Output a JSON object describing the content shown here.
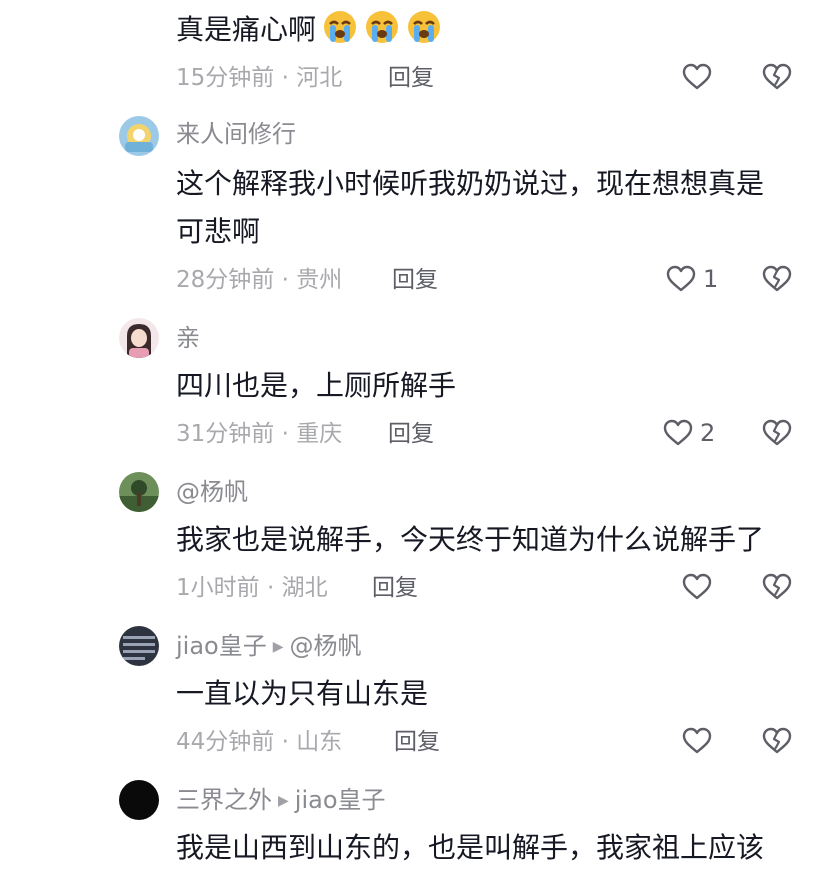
{
  "comments": [
    {
      "content": "真是痛心啊",
      "emoji_count": 3,
      "time": "15分钟前",
      "location": "河北",
      "reply_label": "回复",
      "likes": ""
    },
    {
      "username": "来人间修行",
      "content_line1": "这个解释我小时候听我奶奶说过，现在想想真是",
      "content_line2": "可悲啊",
      "time": "28分钟前",
      "location": "贵州",
      "reply_label": "回复",
      "likes": "1"
    },
    {
      "username": "亲",
      "content": "四川也是，上厕所解手",
      "time": "31分钟前",
      "location": "重庆",
      "reply_label": "回复",
      "likes": "2"
    },
    {
      "username": "@杨帆",
      "content": "我家也是说解手，今天终于知道为什么说解手了",
      "time": "1小时前",
      "location": "湖北",
      "reply_label": "回复",
      "likes": ""
    },
    {
      "username": "jiao皇子",
      "reply_to": "@杨帆",
      "content": "一直以为只有山东是",
      "time": "44分钟前",
      "location": "山东",
      "reply_label": "回复",
      "likes": ""
    },
    {
      "username": "三界之外",
      "reply_to": "jiao皇子",
      "content": "我是山西到山东的，也是叫解手，我家祖上应该"
    }
  ],
  "icons": {
    "like": "heart-outline-icon",
    "dislike": "broken-heart-icon",
    "reply_arrow": "triangle-right-icon",
    "emoji": "loudly-crying-face-emoji"
  },
  "colors": {
    "text": "#161823",
    "meta": "#a8a9ad",
    "username": "#8a8b91",
    "reply": "#5d5e66",
    "icon": "#5d5e66"
  }
}
